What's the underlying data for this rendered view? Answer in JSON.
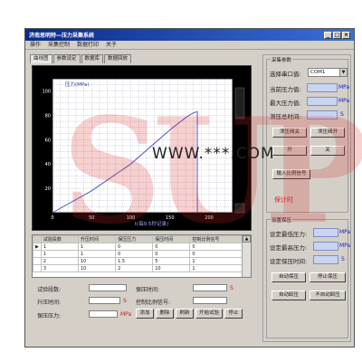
{
  "window": {
    "title": "济南思明特—压力采集系统",
    "controls": [
      "_",
      "□",
      "×"
    ]
  },
  "menu": [
    "操作",
    "采集控制",
    "数据打印",
    "关于"
  ],
  "tabs": [
    {
      "label": "曲线图",
      "active": true
    },
    {
      "label": "参数设定",
      "active": false
    },
    {
      "label": "数据库",
      "active": false
    },
    {
      "label": "数据回放",
      "active": false
    }
  ],
  "chart_data": {
    "type": "line",
    "ylabel": "压力(MPa)",
    "xlabel": "t(每0.5秒记录)",
    "x_ticks": [
      "0",
      "50",
      "100",
      "150",
      "200"
    ],
    "y_ticks": [
      "20",
      "40",
      "60",
      "80",
      "100"
    ],
    "xlim": [
      0,
      230
    ],
    "ylim": [
      0,
      110
    ],
    "grid": true,
    "background": "#000000",
    "line_color": "#4a5ac8",
    "series": [
      {
        "x": [
          0,
          50,
          100,
          150,
          170,
          180,
          185
        ],
        "y": [
          0,
          18,
          40,
          68,
          78,
          82,
          83
        ]
      }
    ],
    "marker": {
      "x": 185,
      "y_from": 83,
      "y_to": 0
    }
  },
  "table": {
    "columns": [
      "试验段数",
      "升压时间",
      "保压压力",
      "保压时间",
      "控制比例信号"
    ],
    "rows": [
      [
        "1",
        "1",
        "0",
        "0",
        "0"
      ],
      [
        "1",
        "1",
        "0",
        "0",
        "0"
      ],
      [
        "2",
        "10",
        "1.5",
        "5",
        "1"
      ],
      [
        "3",
        "10",
        "2",
        "10",
        "1"
      ]
    ]
  },
  "bottom_form": {
    "segments_label": "试验段数:",
    "hold_time_label": "保压时间:",
    "rise_time_label": "升压时间:",
    "ctrl_signal_label": "控制比例信号:",
    "hold_pressure_label": "保压压力:",
    "unit_s": "S",
    "unit_s2": "S",
    "unit_mpa": "MPa",
    "buttons": [
      "添加",
      "删除",
      "刷新",
      "开始试验",
      "停止"
    ]
  },
  "right_panel": {
    "group1_title": "采集参数",
    "port_label": "选择串口值:",
    "port_value": "COM1",
    "current_pressure_label": "当前压力值:",
    "max_pressure_label": "最大压力值:",
    "total_time_label": "测压总时间:",
    "unit_mpa": "MPa",
    "unit_s": "S",
    "buttons_row1": [
      "泄压阀关",
      "泄压阀开"
    ],
    "buttons_row2": [
      "开",
      "关"
    ],
    "input_ratio_button": "输入比例信号",
    "status_text": "保计时",
    "group2_title": "设置保压",
    "set_max_label": "设定最低压力:",
    "set_high_label": "设定最高压力:",
    "set_time_label": "设定保压时间:",
    "buttons_row3": [
      "自动保压",
      "停止保压"
    ],
    "buttons_row4": [
      "自动卸压",
      "不自动卸压"
    ]
  },
  "watermark": {
    "logo": "SUP",
    "text": "WWW.***.COM"
  }
}
